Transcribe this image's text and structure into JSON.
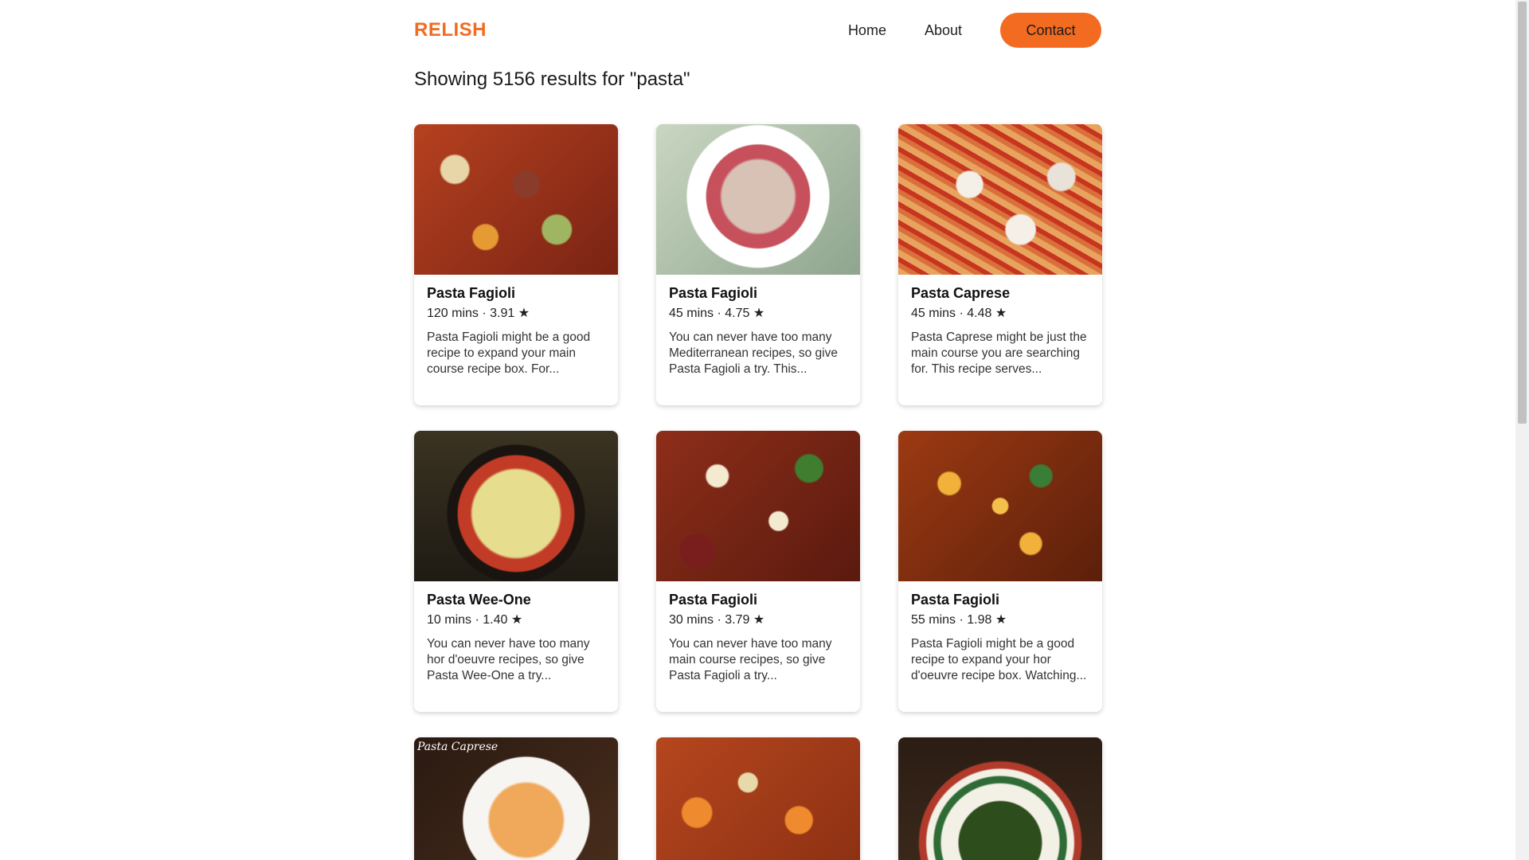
{
  "header": {
    "logo": "RELISH",
    "nav": [
      "Home",
      "About"
    ],
    "contact": "Contact"
  },
  "results_text": "Showing 5156 results for \"pasta\"",
  "cards": [
    {
      "title": "Pasta Fagioli",
      "meta": "120 mins · 3.91 ★",
      "desc": "Pasta Fagioli might be a good recipe to expand your main course recipe box. For..."
    },
    {
      "title": "Pasta Fagioli",
      "meta": "45 mins · 4.75 ★",
      "desc": "You can never have too many Mediterranean recipes, so give Pasta Fagioli a try. This..."
    },
    {
      "title": "Pasta Caprese",
      "meta": "45 mins · 4.48 ★",
      "desc": "Pasta Caprese might be just the main course you are searching for. This recipe serves..."
    },
    {
      "title": "Pasta Wee-One",
      "meta": "10 mins · 1.40 ★",
      "desc": "You can never have too many hor d'oeuvre recipes, so give Pasta Wee-One a try..."
    },
    {
      "title": "Pasta Fagioli",
      "meta": "30 mins · 3.79 ★",
      "desc": "You can never have too many main course recipes, so give Pasta Fagioli a try..."
    },
    {
      "title": "Pasta Fagioli",
      "meta": "55 mins · 1.98 ★",
      "desc": "Pasta Fagioli might be a good recipe to expand your hor d'oeuvre recipe box. Watching..."
    }
  ],
  "image_label_7": "Pasta Caprese"
}
